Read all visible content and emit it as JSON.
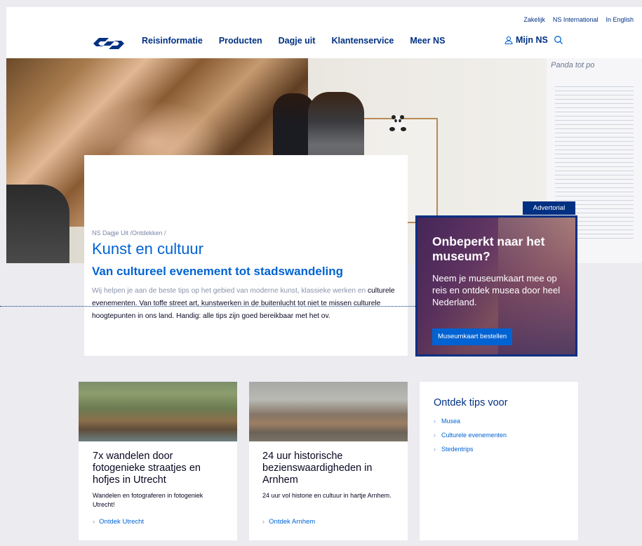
{
  "header": {
    "util_links": [
      "Zakelijk",
      "NS International",
      "In English"
    ],
    "nav": [
      "Reisinformatie",
      "Producten",
      "Dagje uit",
      "Klantenservice",
      "Meer NS"
    ],
    "mijn_ns": "Mijn NS",
    "logo_icon": "ns-logo-icon",
    "search_icon": "search-icon",
    "brand_color": "#003082",
    "link_color": "#0063d3"
  },
  "hero": {
    "wall_text": "Panda tot po"
  },
  "intro": {
    "breadcrumb": "NS Dagje Uit /Ontdekken /",
    "title": "Kunst en cultuur",
    "subtitle": "Van cultureel evenement tot stadswandeling",
    "text_faded": "Wij helpen je aan de beste tips op het gebied van moderne kunst, klassieke werken en",
    "text_main": "culturele evenementen. Van toffe street art, kunstwerken in de buitenlucht tot niet te missen culturele hoogtepunten in ons land. Handig: alle tips zijn goed bereikbaar met het ov."
  },
  "advertorial": {
    "label": "Advertorial",
    "title": "Onbeperkt naar het museum?",
    "text": "Neem je museumkaart mee op reis en ontdek musea door heel Nederland.",
    "button": "Museumkaart bestellen"
  },
  "cards": [
    {
      "title": "7x wandelen door fotogenieke straatjes en hofjes in Utrecht",
      "desc": "Wandelen en fotograferen in fotogeniek Utrecht!",
      "link": "Ontdek Utrecht"
    },
    {
      "title": "24 uur historische bezienswaardigheden in Arnhem",
      "desc": "24 uur vol historie en cultuur in hartje Arnhem.",
      "link": "Ontdek Arnhem"
    }
  ],
  "tips": {
    "title": "Ontdek tips voor",
    "items": [
      "Musea",
      "Culturele evenementen",
      "Stedentrips"
    ]
  }
}
